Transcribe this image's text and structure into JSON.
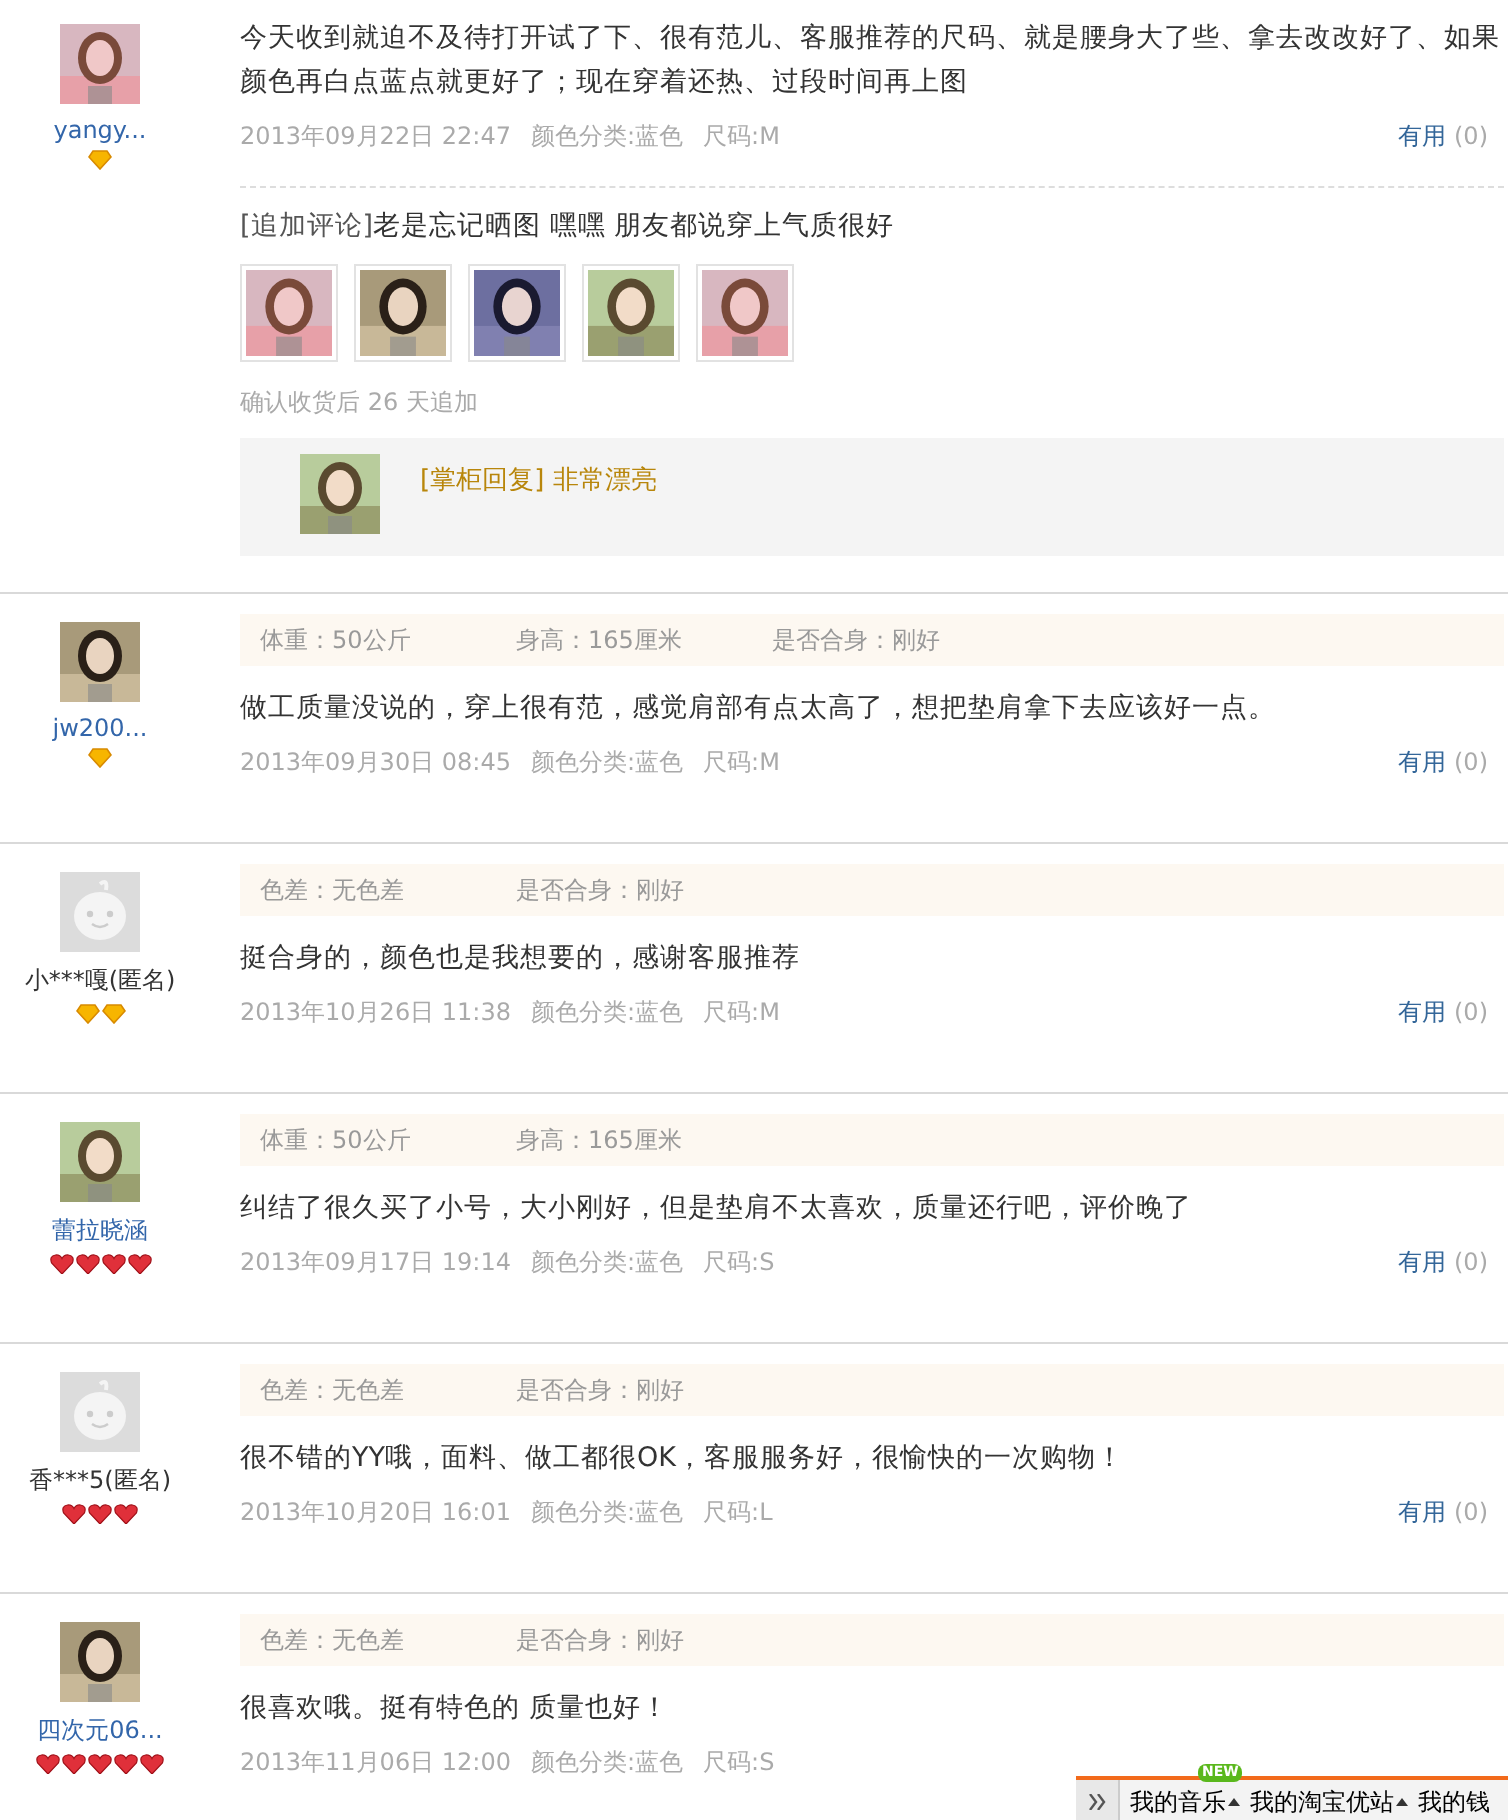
{
  "reviews": [
    {
      "user": {
        "name": "yangy...",
        "anonymous": false,
        "badges": [
          {
            "kind": "diamond"
          }
        ]
      },
      "text": "今天收到就迫不及待打开试了下、很有范儿、客服推荐的尺码、就是腰身大了些、拿去改改好了、如果颜色再白点蓝点就更好了；现在穿着还热、过段时间再上图",
      "meta": [
        "2013年09月22日 22:47",
        "颜色分类:蓝色",
        "尺码:M"
      ],
      "vote": {
        "label": "有用",
        "count": "(0)"
      },
      "followup": {
        "label": "[追加评论]",
        "text": "老是忘记晒图 嘿嘿 朋友都说穿上气质很好",
        "note": "确认收货后 26 天追加"
      },
      "reply": {
        "label": "[掌柜回复]",
        "text": "非常漂亮"
      }
    },
    {
      "user": {
        "name": "jw200...",
        "anonymous": false,
        "badges": [
          {
            "kind": "diamond"
          }
        ]
      },
      "attributes": [
        "体重：50公斤",
        "身高：165厘米",
        "是否合身：刚好"
      ],
      "text": "做工质量没说的，穿上很有范，感觉肩部有点太高了，想把垫肩拿下去应该好一点。",
      "meta": [
        "2013年09月30日 08:45",
        "颜色分类:蓝色",
        "尺码:M"
      ],
      "vote": {
        "label": "有用",
        "count": "(0)"
      }
    },
    {
      "user": {
        "name": "小***嘎(匿名)",
        "anonymous": true,
        "avatar": {
          "kind": "default"
        },
        "badges": [
          {
            "kind": "diamond"
          },
          {
            "kind": "diamond"
          }
        ]
      },
      "attributes": [
        "色差：无色差",
        "是否合身：刚好"
      ],
      "text": "挺合身的，颜色也是我想要的，感谢客服推荐",
      "meta": [
        "2013年10月26日 11:38",
        "颜色分类:蓝色",
        "尺码:M"
      ],
      "vote": {
        "label": "有用",
        "count": "(0)"
      }
    },
    {
      "user": {
        "name": "蕾拉晓涵",
        "anonymous": false,
        "badges": [
          {
            "kind": "heart"
          },
          {
            "kind": "heart"
          },
          {
            "kind": "heart"
          },
          {
            "kind": "heart"
          }
        ]
      },
      "attributes": [
        "体重：50公斤",
        "身高：165厘米"
      ],
      "text": "纠结了很久买了小号，大小刚好，但是垫肩不太喜欢，质量还行吧，评价晚了",
      "meta": [
        "2013年09月17日 19:14",
        "颜色分类:蓝色",
        "尺码:S"
      ],
      "vote": {
        "label": "有用",
        "count": "(0)"
      }
    },
    {
      "user": {
        "name": "香***5(匿名)",
        "anonymous": true,
        "avatar": {
          "kind": "default"
        },
        "badges": [
          {
            "kind": "heart"
          },
          {
            "kind": "heart"
          },
          {
            "kind": "heart"
          }
        ]
      },
      "attributes": [
        "色差：无色差",
        "是否合身：刚好"
      ],
      "text": "很不错的YY哦，面料、做工都很OK，客服服务好，很愉快的一次购物！",
      "meta": [
        "2013年10月20日 16:01",
        "颜色分类:蓝色",
        "尺码:L"
      ],
      "vote": {
        "label": "有用",
        "count": "(0)"
      }
    },
    {
      "user": {
        "name": "四次元06...",
        "anonymous": false,
        "badges": [
          {
            "kind": "heart"
          },
          {
            "kind": "heart"
          },
          {
            "kind": "heart"
          },
          {
            "kind": "heart"
          },
          {
            "kind": "heart"
          }
        ]
      },
      "attributes": [
        "色差：无色差",
        "是否合身：刚好"
      ],
      "text": "很喜欢哦。挺有特色的 质量也好！",
      "meta": [
        "2013年11月06日 12:00",
        "颜色分类:蓝色",
        "尺码:S"
      ]
    }
  ],
  "toolbar": {
    "items": [
      {
        "label": "我的音乐",
        "menu": true,
        "badge": "NEW"
      },
      {
        "label": "我的淘宝优站",
        "menu": true
      },
      {
        "label": "我的钱",
        "menu": false
      }
    ]
  }
}
